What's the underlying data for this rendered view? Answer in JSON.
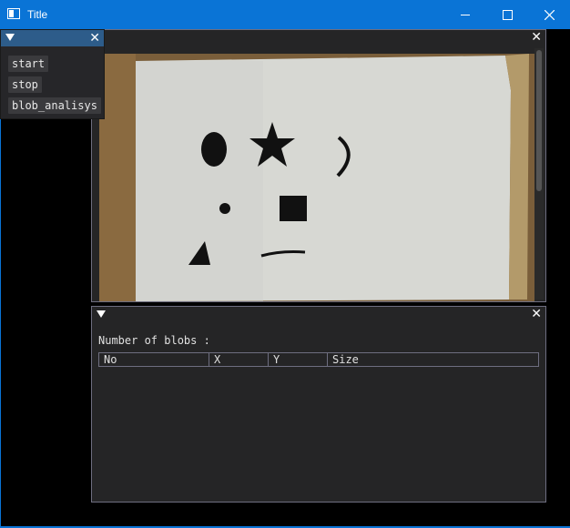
{
  "window": {
    "title": "Title",
    "icons": {
      "app": "app-window-icon",
      "minimize": "minimize-icon",
      "maximize": "maximize-icon",
      "close": "close-icon"
    },
    "accent_color": "#0a74d6"
  },
  "controls_panel": {
    "buttons": [
      "start",
      "stop",
      "blob_analisys"
    ]
  },
  "video_panel": {
    "content": "camera-frame-image"
  },
  "blob_panel": {
    "label": "Number of blobs :",
    "table_headers": [
      "No",
      "X",
      "Y",
      "Size"
    ],
    "rows": []
  }
}
